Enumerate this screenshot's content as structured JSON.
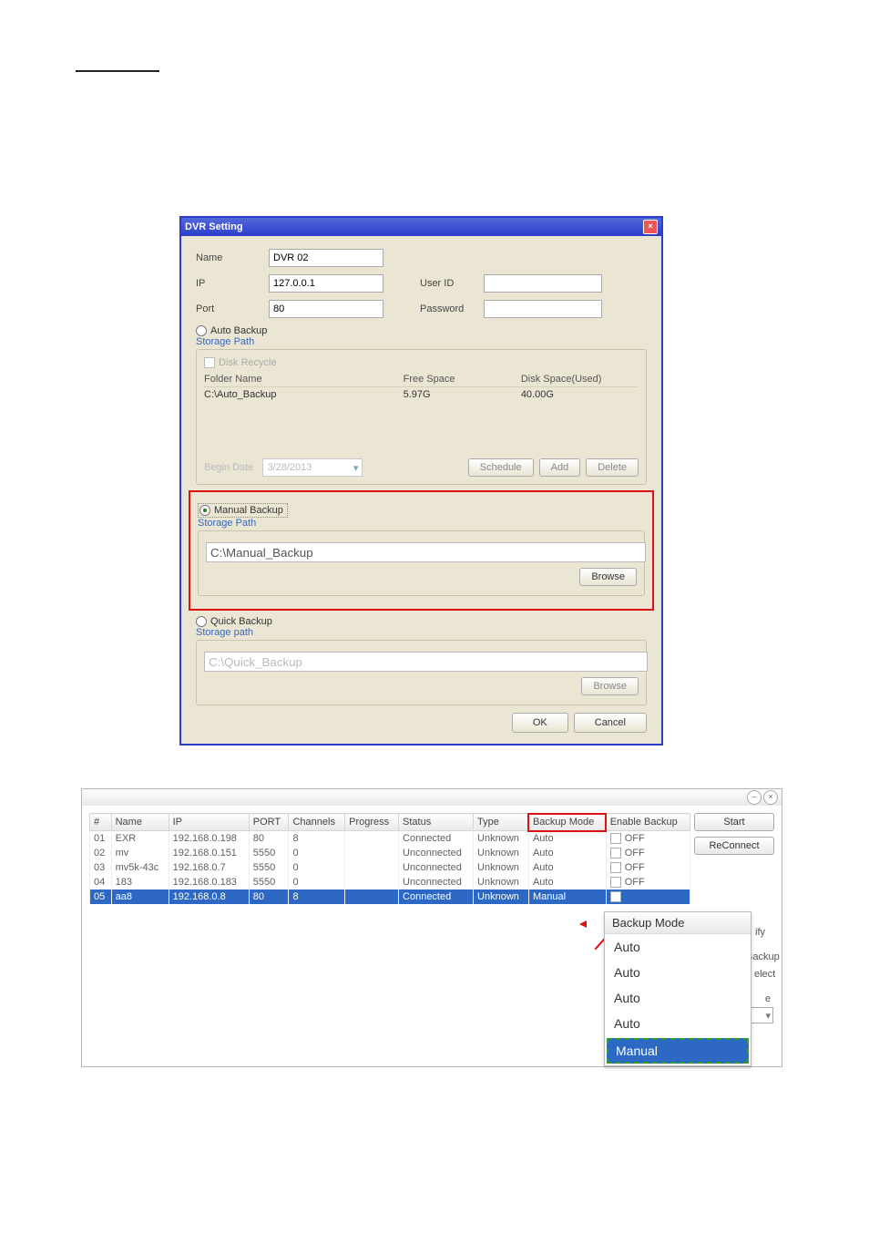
{
  "dvr": {
    "title": "DVR Setting",
    "labels": {
      "name": "Name",
      "ip": "IP",
      "port": "Port",
      "userid": "User ID",
      "password": "Password"
    },
    "values": {
      "name": "DVR 02",
      "ip": "127.0.0.1",
      "port": "80",
      "userid": "",
      "password": ""
    },
    "auto": {
      "radio": "Auto Backup",
      "legend": "Storage Path",
      "disk_recycle": "Disk Recycle",
      "hdr": {
        "folder": "Folder Name",
        "free": "Free Space",
        "used": "Disk Space(Used)"
      },
      "row": {
        "folder": "C:\\Auto_Backup",
        "free": "5.97G",
        "used": "40.00G"
      },
      "begin_date_label": "Begin Date",
      "begin_date_value": "3/28/2013",
      "btn_schedule": "Schedule",
      "btn_add": "Add",
      "btn_delete": "Delete"
    },
    "manual": {
      "radio": "Manual Backup",
      "legend": "Storage Path",
      "path": "C:\\Manual_Backup",
      "browse": "Browse"
    },
    "quick": {
      "radio": "Quick Backup",
      "legend": "Storage path",
      "path": "C:\\Quick_Backup",
      "browse": "Browse"
    },
    "ok": "OK",
    "cancel": "Cancel"
  },
  "app": {
    "headers": [
      "#",
      "Name",
      "IP",
      "PORT",
      "Channels",
      "Progress",
      "Status",
      "Type",
      "Backup Mode",
      "Enable Backup"
    ],
    "rows": [
      {
        "n": "01",
        "name": "EXR",
        "ip": "192.168.0.198",
        "port": "80",
        "ch": "8",
        "prog": "",
        "status": "Connected",
        "type": "Unknown",
        "mode": "Auto",
        "enable": "OFF"
      },
      {
        "n": "02",
        "name": "mv",
        "ip": "192.168.0.151",
        "port": "5550",
        "ch": "0",
        "prog": "",
        "status": "Unconnected",
        "type": "Unknown",
        "mode": "Auto",
        "enable": "OFF"
      },
      {
        "n": "03",
        "name": "mv5k-43c",
        "ip": "192.168.0.7",
        "port": "5550",
        "ch": "0",
        "prog": "",
        "status": "Unconnected",
        "type": "Unknown",
        "mode": "Auto",
        "enable": "OFF"
      },
      {
        "n": "04",
        "name": "183",
        "ip": "192.168.0.183",
        "port": "5550",
        "ch": "0",
        "prog": "",
        "status": "Unconnected",
        "type": "Unknown",
        "mode": "Auto",
        "enable": "OFF"
      },
      {
        "n": "05",
        "name": "aa8",
        "ip": "192.168.0.8",
        "port": "80",
        "ch": "8",
        "prog": "",
        "status": "Connected",
        "type": "Unknown",
        "mode": "Manual",
        "enable": ""
      }
    ],
    "side": {
      "start": "Start",
      "reconnect": "ReConnect",
      "ify": "ify",
      "backup": "Backup",
      "select": "elect",
      "e": "e"
    },
    "menu": {
      "title": "Backup Mode",
      "items": [
        "Auto",
        "Auto",
        "Auto",
        "Auto"
      ],
      "selected": "Manual"
    }
  }
}
